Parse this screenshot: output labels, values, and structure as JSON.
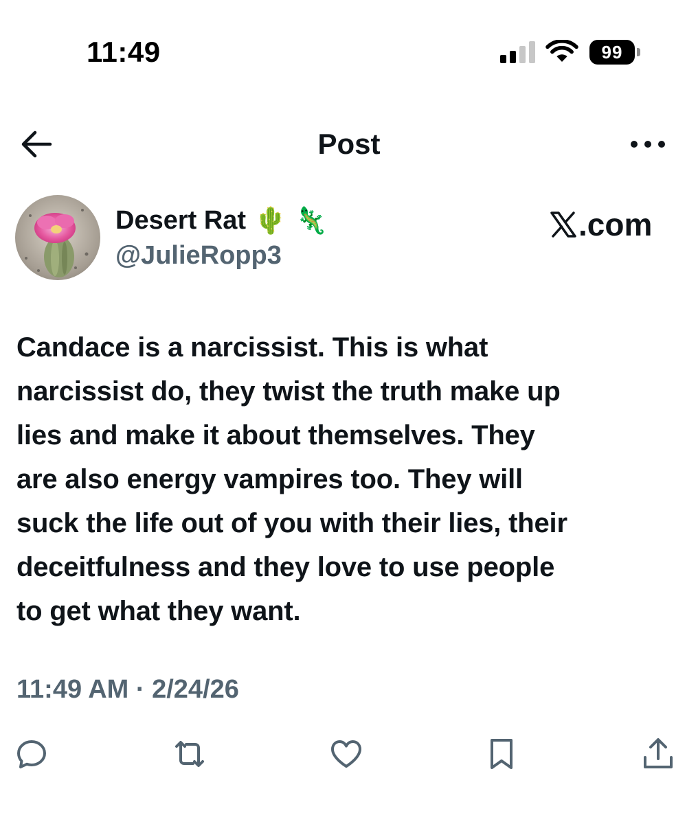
{
  "status_bar": {
    "time": "11:49",
    "battery": "99"
  },
  "header": {
    "title": "Post",
    "back_icon": "arrow-left-icon",
    "more_icon": "more-horizontal-icon"
  },
  "author": {
    "display_name": "Desert Rat",
    "emojis": [
      "🌵",
      "🦎"
    ],
    "handle": "@JulieRopp3"
  },
  "branding": {
    "site": ".com",
    "logo_icon": "x-logo-icon"
  },
  "post": {
    "text": "Candace is a narcissist. This is what\nnarcissist do, they twist the truth  make up\nlies and make it about themselves.  They\nare also energy vampires too. They will\nsuck the life out of you with their lies, their\ndeceitfulness and they love to use people\nto get what they want.",
    "meta": "11:49 AM · 2/24/26"
  },
  "actions": [
    {
      "name": "reply",
      "icon": "reply-icon"
    },
    {
      "name": "repost",
      "icon": "repost-icon"
    },
    {
      "name": "like",
      "icon": "heart-icon"
    },
    {
      "name": "bookmark",
      "icon": "bookmark-icon"
    },
    {
      "name": "share",
      "icon": "share-icon"
    }
  ],
  "colors": {
    "text_primary": "#0f1419",
    "text_secondary": "#536471",
    "background": "#ffffff"
  }
}
